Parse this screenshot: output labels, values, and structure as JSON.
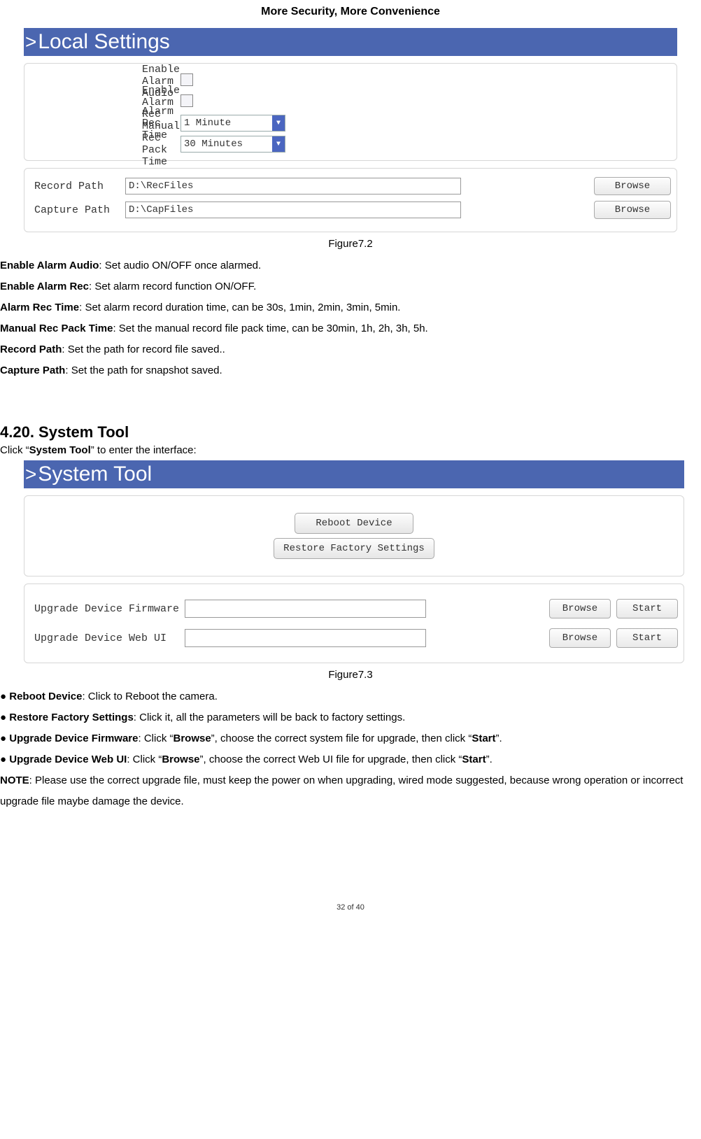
{
  "header": "More Security, More Convenience",
  "figure1": {
    "titleBar": "Local Settings",
    "rows": {
      "enableAlarmAudio": "Enable Alarm Audio",
      "enableAlarmRec": "Enable Alarm Rec",
      "alarmRecTime": "Alarm Rec Time",
      "alarmRecTimeValue": "1 Minute",
      "manualRecPackTime": "Manual Rec Pack Time",
      "manualRecPackTimeValue": "30 Minutes"
    },
    "paths": {
      "recordPathLabel": "Record Path",
      "recordPathValue": "D:\\RecFiles",
      "capturePathLabel": "Capture Path",
      "capturePathValue": "D:\\CapFiles",
      "browse": "Browse"
    },
    "caption": "Figure7.2"
  },
  "descriptions1": {
    "l1_b": "Enable Alarm Audio",
    "l1_t": ": Set audio ON/OFF once alarmed.",
    "l2_b": "Enable Alarm Rec",
    "l2_t": ": Set alarm record function ON/OFF.",
    "l3_b": "Alarm Rec Time",
    "l3_t": ": Set alarm record duration time, can be 30s, 1min, 2min, 3min, 5min.",
    "l4_b": "Manual Rec Pack Time",
    "l4_t": ": Set the manual record file pack time, can be 30min, 1h, 2h, 3h, 5h.",
    "l5_b": "Record Path",
    "l5_t": ": Set the path for record file saved..",
    "l6_b": "Capture Path",
    "l6_t": ": Set the path for snapshot saved."
  },
  "section": {
    "h2": "4.20. System Tool",
    "intro_pre": "Click “",
    "intro_b": "System Tool",
    "intro_post": "” to enter the interface:"
  },
  "figure2": {
    "titleBar": "System Tool",
    "rebootBtn": "Reboot Device",
    "restoreBtn": "Restore Factory Settings",
    "upgradeFirmwareLabel": "Upgrade Device Firmware",
    "upgradeWebUILabel": "Upgrade Device Web UI",
    "browse": "Browse",
    "start": "Start",
    "caption": "Figure7.3"
  },
  "descriptions2": {
    "l1_pre": "● ",
    "l1_b": "Reboot Device",
    "l1_t": ": Click to Reboot the camera.",
    "l2_pre": "● ",
    "l2_b": "Restore Factory Settings",
    "l2_t": ": Click it, all the parameters will be back to factory settings.",
    "l3_pre": "● ",
    "l3_b": "Upgrade Device Firmware",
    "l3_t1": ": Click “",
    "l3_b2": "Browse",
    "l3_t2": "”, choose the correct system file for upgrade, then click “",
    "l3_b3": "Start",
    "l3_t3": "”.",
    "l4_pre": "● ",
    "l4_b": "Upgrade Device Web UI",
    "l4_t1": ": Click “",
    "l4_b2": "Browse",
    "l4_t2": "”, choose the correct Web UI file for upgrade, then click “",
    "l4_b3": "Start",
    "l4_t3": "”.",
    "note_b": "NOTE",
    "note_t": ": Please use the correct upgrade file, must keep the power on when upgrading, wired mode suggested, because wrong operation or incorrect upgrade file maybe damage the device."
  },
  "footer": "32 of 40"
}
